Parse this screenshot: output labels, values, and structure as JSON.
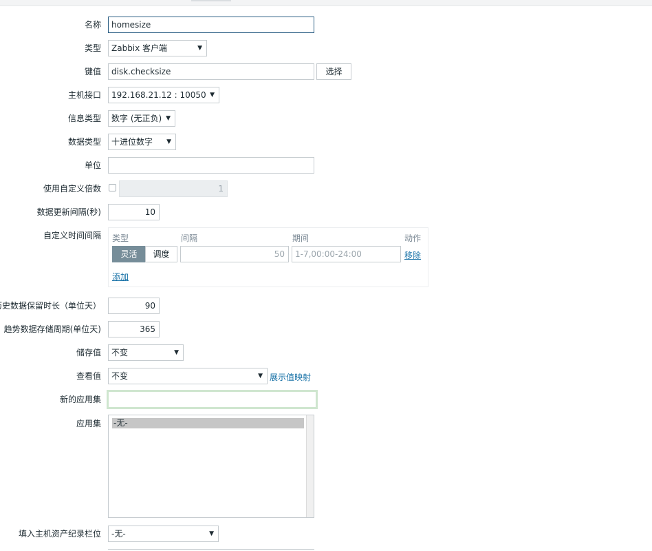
{
  "form": {
    "name": {
      "label": "名称",
      "value": "homesize"
    },
    "type": {
      "label": "类型",
      "value": "Zabbix 客户端"
    },
    "key": {
      "label": "键值",
      "value": "disk.checksize",
      "button": "选择"
    },
    "host_interface": {
      "label": "主机接口",
      "value": "192.168.21.12 : 10050"
    },
    "info_type": {
      "label": "信息类型",
      "value": "数字 (无正负)"
    },
    "data_type": {
      "label": "数据类型",
      "value": "十进位数字"
    },
    "units": {
      "label": "单位",
      "value": ""
    },
    "custom_multiplier": {
      "label": "使用自定义倍数",
      "value": "1",
      "checked": false
    },
    "update_interval": {
      "label": "数据更新间隔(秒)",
      "value": "10"
    },
    "custom_intervals": {
      "label": "自定义时间间隔",
      "headers": {
        "type": "类型",
        "interval": "间隔",
        "period": "期间",
        "action": "动作"
      },
      "row": {
        "flexible": "灵活",
        "scheduling": "调度",
        "interval": "50",
        "period": "1-7,00:00-24:00",
        "remove": "移除"
      },
      "add": "添加"
    },
    "history": {
      "label": "历史数据保留时长（单位天）",
      "value": "90"
    },
    "trends": {
      "label": "趋势数据存储周期(单位天)",
      "value": "365"
    },
    "store_value": {
      "label": "储存值",
      "value": "不变"
    },
    "show_value": {
      "label": "查看值",
      "value": "不变",
      "link": "展示值映射"
    },
    "new_application": {
      "label": "新的应用集",
      "value": ""
    },
    "applications": {
      "label": "应用集",
      "items": [
        "-无-"
      ]
    },
    "inventory_field": {
      "label": "填入主机资产纪录栏位",
      "value": "-无-"
    }
  },
  "icons": {
    "dropdown": "▼"
  }
}
